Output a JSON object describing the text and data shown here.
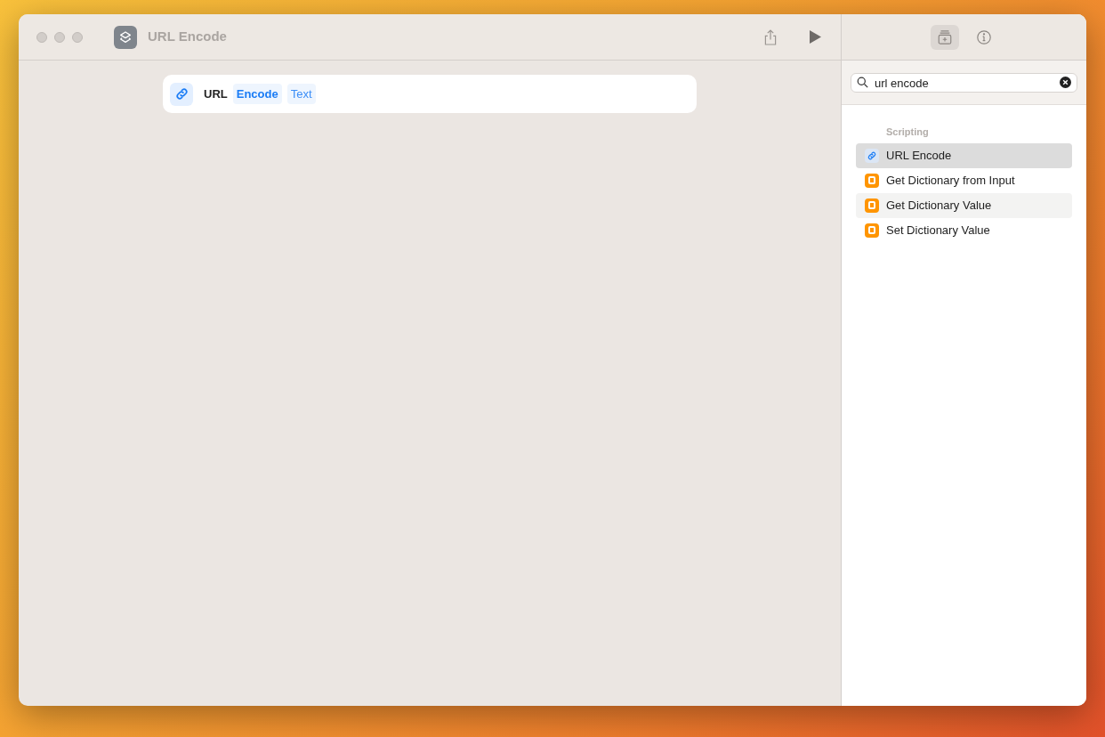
{
  "window": {
    "title": "URL Encode"
  },
  "action": {
    "parts": [
      {
        "text": "URL",
        "kind": "label"
      },
      {
        "text": "Encode",
        "kind": "parameter"
      },
      {
        "text": "Text",
        "kind": "variable"
      }
    ]
  },
  "sidebar": {
    "tabs": [
      {
        "kind": "library",
        "selected": true
      },
      {
        "kind": "info",
        "selected": false
      }
    ],
    "search": {
      "value": "url encode"
    },
    "section": "Scripting",
    "items": [
      {
        "label": "URL Encode",
        "kind": "link",
        "selected": true,
        "hovered": false
      },
      {
        "label": "Get Dictionary from Input",
        "kind": "dictionary",
        "selected": false,
        "hovered": false
      },
      {
        "label": "Get Dictionary Value",
        "kind": "dictionary",
        "selected": false,
        "hovered": true
      },
      {
        "label": "Set Dictionary Value",
        "kind": "dictionary",
        "selected": false,
        "hovered": false
      }
    ]
  }
}
